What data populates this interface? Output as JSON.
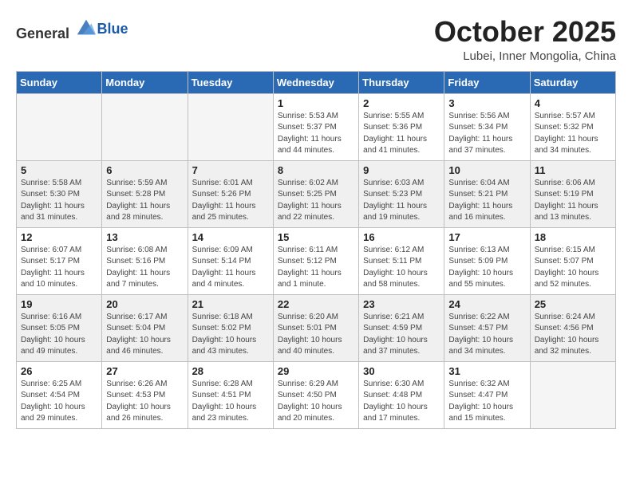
{
  "header": {
    "logo_general": "General",
    "logo_blue": "Blue",
    "month": "October 2025",
    "location": "Lubei, Inner Mongolia, China"
  },
  "weekdays": [
    "Sunday",
    "Monday",
    "Tuesday",
    "Wednesday",
    "Thursday",
    "Friday",
    "Saturday"
  ],
  "weeks": [
    [
      {
        "day": "",
        "sunrise": "",
        "sunset": "",
        "daylight": "",
        "empty": true
      },
      {
        "day": "",
        "sunrise": "",
        "sunset": "",
        "daylight": "",
        "empty": true
      },
      {
        "day": "",
        "sunrise": "",
        "sunset": "",
        "daylight": "",
        "empty": true
      },
      {
        "day": "1",
        "sunrise": "Sunrise: 5:53 AM",
        "sunset": "Sunset: 5:37 PM",
        "daylight": "Daylight: 11 hours and 44 minutes."
      },
      {
        "day": "2",
        "sunrise": "Sunrise: 5:55 AM",
        "sunset": "Sunset: 5:36 PM",
        "daylight": "Daylight: 11 hours and 41 minutes."
      },
      {
        "day": "3",
        "sunrise": "Sunrise: 5:56 AM",
        "sunset": "Sunset: 5:34 PM",
        "daylight": "Daylight: 11 hours and 37 minutes."
      },
      {
        "day": "4",
        "sunrise": "Sunrise: 5:57 AM",
        "sunset": "Sunset: 5:32 PM",
        "daylight": "Daylight: 11 hours and 34 minutes."
      }
    ],
    [
      {
        "day": "5",
        "sunrise": "Sunrise: 5:58 AM",
        "sunset": "Sunset: 5:30 PM",
        "daylight": "Daylight: 11 hours and 31 minutes."
      },
      {
        "day": "6",
        "sunrise": "Sunrise: 5:59 AM",
        "sunset": "Sunset: 5:28 PM",
        "daylight": "Daylight: 11 hours and 28 minutes."
      },
      {
        "day": "7",
        "sunrise": "Sunrise: 6:01 AM",
        "sunset": "Sunset: 5:26 PM",
        "daylight": "Daylight: 11 hours and 25 minutes."
      },
      {
        "day": "8",
        "sunrise": "Sunrise: 6:02 AM",
        "sunset": "Sunset: 5:25 PM",
        "daylight": "Daylight: 11 hours and 22 minutes."
      },
      {
        "day": "9",
        "sunrise": "Sunrise: 6:03 AM",
        "sunset": "Sunset: 5:23 PM",
        "daylight": "Daylight: 11 hours and 19 minutes."
      },
      {
        "day": "10",
        "sunrise": "Sunrise: 6:04 AM",
        "sunset": "Sunset: 5:21 PM",
        "daylight": "Daylight: 11 hours and 16 minutes."
      },
      {
        "day": "11",
        "sunrise": "Sunrise: 6:06 AM",
        "sunset": "Sunset: 5:19 PM",
        "daylight": "Daylight: 11 hours and 13 minutes."
      }
    ],
    [
      {
        "day": "12",
        "sunrise": "Sunrise: 6:07 AM",
        "sunset": "Sunset: 5:17 PM",
        "daylight": "Daylight: 11 hours and 10 minutes."
      },
      {
        "day": "13",
        "sunrise": "Sunrise: 6:08 AM",
        "sunset": "Sunset: 5:16 PM",
        "daylight": "Daylight: 11 hours and 7 minutes."
      },
      {
        "day": "14",
        "sunrise": "Sunrise: 6:09 AM",
        "sunset": "Sunset: 5:14 PM",
        "daylight": "Daylight: 11 hours and 4 minutes."
      },
      {
        "day": "15",
        "sunrise": "Sunrise: 6:11 AM",
        "sunset": "Sunset: 5:12 PM",
        "daylight": "Daylight: 11 hours and 1 minute."
      },
      {
        "day": "16",
        "sunrise": "Sunrise: 6:12 AM",
        "sunset": "Sunset: 5:11 PM",
        "daylight": "Daylight: 10 hours and 58 minutes."
      },
      {
        "day": "17",
        "sunrise": "Sunrise: 6:13 AM",
        "sunset": "Sunset: 5:09 PM",
        "daylight": "Daylight: 10 hours and 55 minutes."
      },
      {
        "day": "18",
        "sunrise": "Sunrise: 6:15 AM",
        "sunset": "Sunset: 5:07 PM",
        "daylight": "Daylight: 10 hours and 52 minutes."
      }
    ],
    [
      {
        "day": "19",
        "sunrise": "Sunrise: 6:16 AM",
        "sunset": "Sunset: 5:05 PM",
        "daylight": "Daylight: 10 hours and 49 minutes."
      },
      {
        "day": "20",
        "sunrise": "Sunrise: 6:17 AM",
        "sunset": "Sunset: 5:04 PM",
        "daylight": "Daylight: 10 hours and 46 minutes."
      },
      {
        "day": "21",
        "sunrise": "Sunrise: 6:18 AM",
        "sunset": "Sunset: 5:02 PM",
        "daylight": "Daylight: 10 hours and 43 minutes."
      },
      {
        "day": "22",
        "sunrise": "Sunrise: 6:20 AM",
        "sunset": "Sunset: 5:01 PM",
        "daylight": "Daylight: 10 hours and 40 minutes."
      },
      {
        "day": "23",
        "sunrise": "Sunrise: 6:21 AM",
        "sunset": "Sunset: 4:59 PM",
        "daylight": "Daylight: 10 hours and 37 minutes."
      },
      {
        "day": "24",
        "sunrise": "Sunrise: 6:22 AM",
        "sunset": "Sunset: 4:57 PM",
        "daylight": "Daylight: 10 hours and 34 minutes."
      },
      {
        "day": "25",
        "sunrise": "Sunrise: 6:24 AM",
        "sunset": "Sunset: 4:56 PM",
        "daylight": "Daylight: 10 hours and 32 minutes."
      }
    ],
    [
      {
        "day": "26",
        "sunrise": "Sunrise: 6:25 AM",
        "sunset": "Sunset: 4:54 PM",
        "daylight": "Daylight: 10 hours and 29 minutes."
      },
      {
        "day": "27",
        "sunrise": "Sunrise: 6:26 AM",
        "sunset": "Sunset: 4:53 PM",
        "daylight": "Daylight: 10 hours and 26 minutes."
      },
      {
        "day": "28",
        "sunrise": "Sunrise: 6:28 AM",
        "sunset": "Sunset: 4:51 PM",
        "daylight": "Daylight: 10 hours and 23 minutes."
      },
      {
        "day": "29",
        "sunrise": "Sunrise: 6:29 AM",
        "sunset": "Sunset: 4:50 PM",
        "daylight": "Daylight: 10 hours and 20 minutes."
      },
      {
        "day": "30",
        "sunrise": "Sunrise: 6:30 AM",
        "sunset": "Sunset: 4:48 PM",
        "daylight": "Daylight: 10 hours and 17 minutes."
      },
      {
        "day": "31",
        "sunrise": "Sunrise: 6:32 AM",
        "sunset": "Sunset: 4:47 PM",
        "daylight": "Daylight: 10 hours and 15 minutes."
      },
      {
        "day": "",
        "sunrise": "",
        "sunset": "",
        "daylight": "",
        "empty": true
      }
    ]
  ]
}
